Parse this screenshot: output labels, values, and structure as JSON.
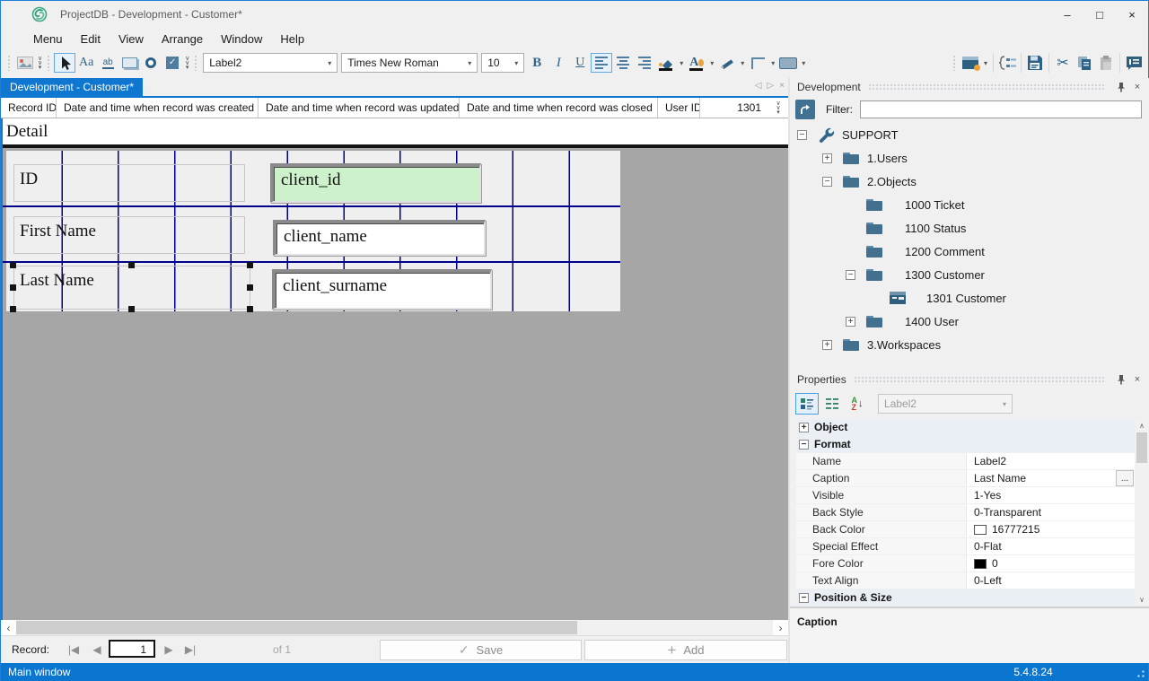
{
  "window": {
    "title": "ProjectDB - Development - Customer*"
  },
  "icons": {
    "minimize": "–",
    "maximize": "□",
    "close": "×",
    "tab_prev": "◁",
    "tab_next": "▷",
    "tab_close": "×",
    "dropdown": "▾",
    "chevron": "∨",
    "overflow_caret": "▾",
    "nav_first": "|◀",
    "nav_prev": "◀",
    "nav_next": "▶",
    "nav_last": "▶|",
    "check": "✓",
    "plus": "+",
    "scroll_left": "‹",
    "scroll_right": "›",
    "scroll_up": "∧",
    "scroll_down": "∨",
    "bold": "B",
    "italic": "I",
    "underline": "U",
    "aa": "Aa",
    "abl": "ab",
    "ellipsis": "...",
    "sort_a": "A",
    "sort_z": "Z",
    "sort_arrow": "↓"
  },
  "menu": {
    "items": [
      "Menu",
      "Edit",
      "View",
      "Arrange",
      "Window",
      "Help"
    ]
  },
  "toolbar": {
    "style_combo": "Label2",
    "font_combo": "Times New Roman",
    "size_combo": "10"
  },
  "tab": {
    "label": "Development - Customer*"
  },
  "record_header": {
    "cells": [
      "Record ID",
      "Date and time when record was created",
      "Date and time when record was updated",
      "Date and time when record was closed",
      "User ID"
    ],
    "value": "1301"
  },
  "designer": {
    "band": "Detail",
    "rows": [
      {
        "label": "ID",
        "field": "client_id"
      },
      {
        "label": "First Name",
        "field": "client_name"
      },
      {
        "label": "Last Name",
        "field": "client_surname"
      }
    ]
  },
  "dev_panel": {
    "title": "Development",
    "filter_label": "Filter:",
    "filter_value": "",
    "tree": [
      {
        "label": "SUPPORT",
        "expander": "−",
        "icon": "wrench"
      },
      {
        "label": "1.Users",
        "expander": "+",
        "icon": "folder"
      },
      {
        "label": "2.Objects",
        "expander": "−",
        "icon": "folder"
      },
      {
        "label": "1000 Ticket",
        "expander": "",
        "icon": "folder"
      },
      {
        "label": "1100 Status",
        "expander": "",
        "icon": "folder"
      },
      {
        "label": "1200 Comment",
        "expander": "",
        "icon": "folder"
      },
      {
        "label": "1300 Customer",
        "expander": "−",
        "icon": "folder"
      },
      {
        "label": "1301 Customer",
        "expander": "",
        "icon": "form"
      },
      {
        "label": "1400 User",
        "expander": "+",
        "icon": "folder"
      },
      {
        "label": "3.Workspaces",
        "expander": "+",
        "icon": "folder"
      }
    ]
  },
  "properties": {
    "title": "Properties",
    "combo": "Label2",
    "section_rows": [
      {
        "label": "Object",
        "exp": "+"
      },
      {
        "label": "Format",
        "exp": "−"
      },
      {
        "label": "Position & Size",
        "exp": "−"
      }
    ],
    "rows": [
      {
        "name": "Name",
        "value": "Label2"
      },
      {
        "name": "Caption",
        "value": "Last Name"
      },
      {
        "name": "Visible",
        "value": "1-Yes"
      },
      {
        "name": "Back Style",
        "value": "0-Transparent"
      },
      {
        "name": "Back Color",
        "value": "16777215",
        "swatch": "#ffffff"
      },
      {
        "name": "Special Effect",
        "value": "0-Flat"
      },
      {
        "name": "Fore Color",
        "value": "0",
        "swatch": "#000000"
      },
      {
        "name": "Text Align",
        "value": "0-Left"
      }
    ],
    "description": "Caption"
  },
  "record_bar": {
    "label": "Record:",
    "value": "1",
    "of": "of  1",
    "save": "Save",
    "add": "Add"
  },
  "status_bar": {
    "left": "Main window",
    "version": "5.4.8.24"
  },
  "colors": {
    "accent_blue": "#0f77d0",
    "grid_navy": "#00008b",
    "field_green": "#cdf2cb",
    "canvas_gray": "#a6a6a6",
    "icon_steel": "#2e6186"
  }
}
